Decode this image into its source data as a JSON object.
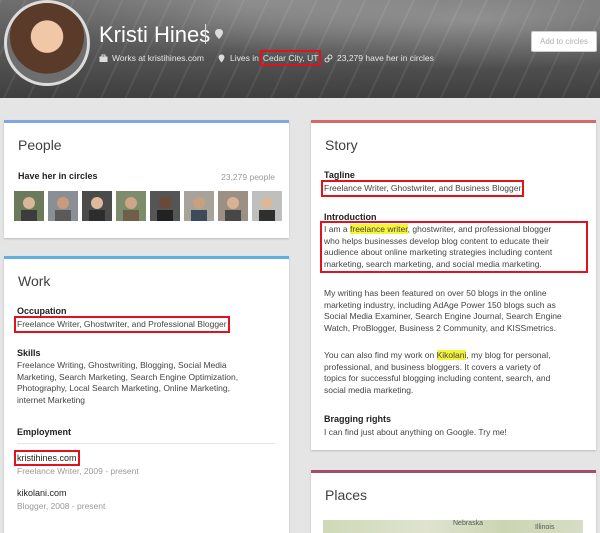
{
  "profile": {
    "name": "Kristi Hines",
    "works_at": "Works at kristihines.com",
    "lives_prefix": "Lives in",
    "lives_city": "Cedar City, UT",
    "followers": "23,279 have her in circles",
    "add_button": "Add to circles"
  },
  "people": {
    "title": "People",
    "subtitle": "Have her in circles",
    "count": "23,279 people",
    "faces": 8
  },
  "work": {
    "title": "Work",
    "occupation_label": "Occupation",
    "occupation_value": "Freelance Writer, Ghostwriter, and Professional Blogger",
    "skills_label": "Skills",
    "skills_lines": [
      "Freelance Writing, Ghostwriting, Blogging, Social Media",
      "Marketing, Search Marketing, Search Engine Optimization,",
      "Photography, Local Search Marketing, Online Marketing,",
      "internet Marketing"
    ],
    "employment_label": "Employment",
    "employment": [
      {
        "name": "kristihines.com",
        "detail": "Freelance Writer, 2009 - present"
      },
      {
        "name": "kikolani.com",
        "detail": "Blogger, 2008 - present"
      }
    ]
  },
  "story": {
    "title": "Story",
    "tagline_label": "Tagline",
    "tagline_value": "Freelance Writer, Ghostwriter, and Business Blogger",
    "intro_label": "Introduction",
    "intro_prefix": "I am a",
    "intro_highlight": "freelance writer",
    "intro_line1_rest": ", ghostwriter, and professional blogger",
    "intro_lines": [
      "who helps businesses develop blog content to educate their",
      "audience about online marketing strategies including content",
      "marketing, search marketing, and social media marketing."
    ],
    "p2_lines": [
      "My writing has been featured on over 50 blogs in the online",
      "marketing industry, including AdAge Power 150 blogs such as",
      "Social Media Examiner, Search Engine Journal, Search Engine",
      "Watch, ProBlogger, Business 2 Community, and KISSmetrics."
    ],
    "p3_prefix": "You can also find my work on",
    "p3_highlight": "Kikolani",
    "p3_line1_rest": ", my blog for personal,",
    "p3_lines": [
      "professional, and business bloggers. It covers a variety of",
      "topics for successful blogging including content, search, and",
      "social media marketing."
    ],
    "bragging_label": "Bragging rights",
    "bragging_value": "I can find just about anything on Google. Try me!"
  },
  "places": {
    "title": "Places",
    "map_labels": [
      "Nebraska",
      "Illinois"
    ]
  },
  "colors": {
    "people_bar": "#7fa8e0",
    "work_bar": "#5fb0e0",
    "story_bar": "#d46a6a",
    "places_bar": "#a64d6f",
    "highlight_box": "#e0121c"
  }
}
